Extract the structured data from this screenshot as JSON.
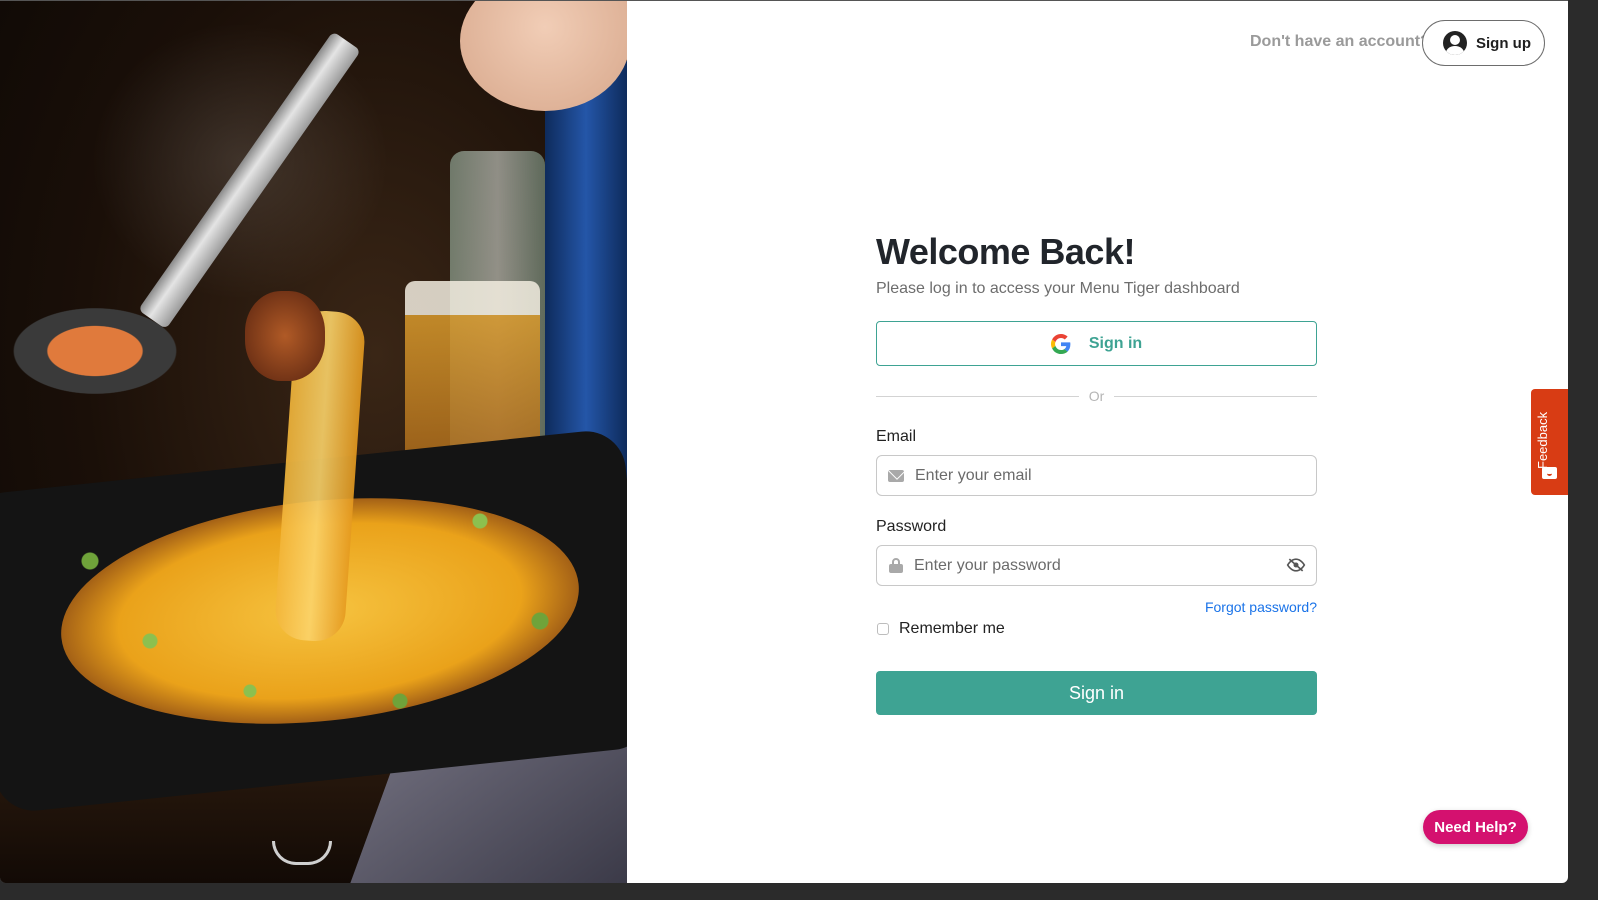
{
  "header": {
    "prompt_text": "Don't have an account?",
    "signup_label": "Sign up"
  },
  "form": {
    "title": "Welcome Back!",
    "subtitle": "Please log in to access your Menu Tiger dashboard",
    "google_signin_label": "Sign in",
    "divider_text": "Or",
    "email": {
      "label": "Email",
      "placeholder": "Enter your email",
      "value": ""
    },
    "password": {
      "label": "Password",
      "placeholder": "Enter your password",
      "value": ""
    },
    "forgot_password_label": "Forgot password?",
    "remember_me_label": "Remember me",
    "remember_me_checked": false,
    "submit_label": "Sign in"
  },
  "widgets": {
    "feedback_label": "Feedback",
    "help_label": "Need Help?"
  },
  "colors": {
    "brand_teal": "#3ea393",
    "link_blue": "#1a73e8",
    "feedback_orange": "#d83c14",
    "help_pink": "#d4116f"
  },
  "hero_image": {
    "description": "Korean cheese dakgalbi with tongs lifting melted cheese, beer and soju bottles in background"
  }
}
